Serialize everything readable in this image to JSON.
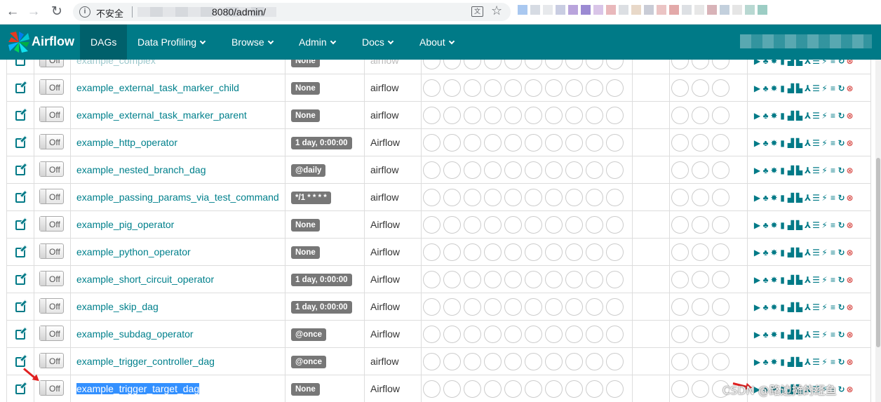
{
  "browser": {
    "back_icon": "arrow-left-icon",
    "forward_icon": "arrow-right-icon",
    "reload_icon": "reload-icon",
    "security_label": "不安全",
    "url": "8080/admin/"
  },
  "navbar": {
    "brand": "Airflow",
    "items": [
      {
        "label": "DAGs",
        "active": true
      },
      {
        "label": "Data Profiling",
        "dropdown": true
      },
      {
        "label": "Browse",
        "dropdown": true
      },
      {
        "label": "Admin",
        "dropdown": true
      },
      {
        "label": "Docs",
        "dropdown": true
      },
      {
        "label": "About",
        "dropdown": true
      }
    ]
  },
  "colors": {
    "navbar": "#007a87",
    "navbar_active": "#00606b",
    "link": "#00808c",
    "label_bg": "#777777",
    "delete": "#d9534f",
    "selection": "#3390ff"
  },
  "toggle_label": "Off",
  "rows": [
    {
      "dag_id": "example_complex",
      "schedule": "None",
      "owner": "airflow",
      "partial": true
    },
    {
      "dag_id": "example_external_task_marker_child",
      "schedule": "None",
      "owner": "airflow"
    },
    {
      "dag_id": "example_external_task_marker_parent",
      "schedule": "None",
      "owner": "airflow"
    },
    {
      "dag_id": "example_http_operator",
      "schedule": "1 day, 0:00:00",
      "owner": "Airflow"
    },
    {
      "dag_id": "example_nested_branch_dag",
      "schedule": "@daily",
      "owner": "airflow"
    },
    {
      "dag_id": "example_passing_params_via_test_command",
      "schedule": "*/1 * * * *",
      "owner": "airflow"
    },
    {
      "dag_id": "example_pig_operator",
      "schedule": "None",
      "owner": "Airflow"
    },
    {
      "dag_id": "example_python_operator",
      "schedule": "None",
      "owner": "Airflow"
    },
    {
      "dag_id": "example_short_circuit_operator",
      "schedule": "1 day, 0:00:00",
      "owner": "Airflow"
    },
    {
      "dag_id": "example_skip_dag",
      "schedule": "1 day, 0:00:00",
      "owner": "Airflow"
    },
    {
      "dag_id": "example_subdag_operator",
      "schedule": "@once",
      "owner": "Airflow"
    },
    {
      "dag_id": "example_trigger_controller_dag",
      "schedule": "@once",
      "owner": "airflow"
    },
    {
      "dag_id": "example_trigger_target_dag",
      "schedule": "None",
      "owner": "Airflow",
      "selected": true
    }
  ],
  "link_icons": [
    "trigger-dag-icon",
    "tree-view-icon",
    "graph-view-icon",
    "tries-icon",
    "landing-times-icon",
    "gantt-icon",
    "task-duration-icon",
    "code-view-icon",
    "logs-icon",
    "refresh-icon",
    "delete-dag-icon"
  ],
  "watermark": "CSDN @路边摊的经鱼"
}
